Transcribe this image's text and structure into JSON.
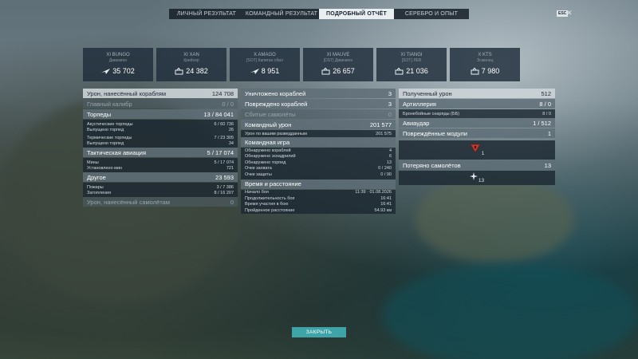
{
  "tabs": [
    "ЛИЧНЫЙ РЕЗУЛЬТАТ",
    "КОМАНДНЫЙ РЕЗУЛЬТАТ",
    "ПОДРОБНЫЙ ОТЧЁТ",
    "СЕРЕБРО И ОПЫТ"
  ],
  "active_tab": "ПОДРОБНЫЙ ОТЧЁТ",
  "esc_label": "ESC",
  "close_glyph": "✕",
  "ships": [
    {
      "name": "XI BUNGO",
      "sub": "Дивизион",
      "value": "35 702"
    },
    {
      "name": "XI XAN",
      "sub": "Крейсер",
      "value": "24 382"
    },
    {
      "name": "X AMAGO",
      "sub": "[SOT] Капитан сбил",
      "value": "8 951"
    },
    {
      "name": "XI MAUVE",
      "sub": "[DST] Дивизион",
      "value": "26 657"
    },
    {
      "name": "XI TIANGI",
      "sub": "[SOT] ЛЕВ",
      "value": "21 036"
    },
    {
      "name": "X KTS",
      "sub": "Эсминец",
      "value": "7 980"
    }
  ],
  "left": {
    "damage": {
      "label": "Урон, нанесённый кораблям",
      "value": "124 708"
    },
    "main_battery": {
      "label": "Главный калибр",
      "value": "0 / 0"
    },
    "torpedoes": {
      "label": "Торпеды",
      "value": "13 / 84 041"
    },
    "acoustic": {
      "label": "Акустические торпеды",
      "value": "6 / 60 736"
    },
    "acoustic_fired": {
      "label": "Выпущено торпед",
      "value": "26"
    },
    "thermal": {
      "label": "Термические торпеды",
      "value": "7 / 23 305"
    },
    "thermal_fired": {
      "label": "Выпущено торпед",
      "value": "34"
    },
    "aviation": {
      "label": "Тактическая авиация",
      "value": "5 / 17 074"
    },
    "mines": {
      "label": "Мины",
      "value": "5 / 17 074"
    },
    "mines_placed": {
      "label": "Установлено мин",
      "value": "721"
    },
    "other": {
      "label": "Другое",
      "value": "23 593"
    },
    "fires": {
      "label": "Пожары",
      "value": "3 / 7 386"
    },
    "floods": {
      "label": "Затопления",
      "value": "8 / 16 207"
    },
    "plane_damage": {
      "label": "Урон, нанесённый самолётам",
      "value": "0"
    }
  },
  "middle": {
    "destroyed": {
      "label": "Уничтожено кораблей",
      "value": "3"
    },
    "damaged": {
      "label": "Повреждено кораблей",
      "value": "3"
    },
    "planes_shot": {
      "label": "Сбитые самолёты",
      "value": "0"
    },
    "team_damage": {
      "label": "Командный урон",
      "value": "201 577"
    },
    "spotting_damage": {
      "label": "Урон по вашим разведданным",
      "value": "201 575"
    },
    "team_game": {
      "label": "Командная игра"
    },
    "detected_ships": {
      "label": "Обнаружено кораблей",
      "value": "4"
    },
    "detected_squadrons": {
      "label": "Обнаружено эскадрилий",
      "value": "6"
    },
    "detected_torpedoes": {
      "label": "Обнаружено торпед",
      "value": "13"
    },
    "capture_points": {
      "label": "Очки захвата",
      "value": "0 / 240"
    },
    "defense_points": {
      "label": "Очки защиты",
      "value": "0 / 90"
    },
    "time_distance": {
      "label": "Время и расстояние"
    },
    "battle_start": {
      "label": "Начало боя",
      "value": "11:39 · 01.08.2026"
    },
    "battle_duration": {
      "label": "Продолжительность боя",
      "value": "16:41"
    },
    "time_in_battle": {
      "label": "Время участия в бою",
      "value": "16:41"
    },
    "distance": {
      "label": "Пройденное расстояние",
      "value": "54.93 км"
    }
  },
  "right": {
    "received": {
      "label": "Полученный урон",
      "value": "512"
    },
    "artillery": {
      "label": "Артиллерия",
      "value": "8 / 0"
    },
    "ap_shells": {
      "label": "Бронебойные снаряды (ББ)",
      "value": "8 / 0"
    },
    "airstrike": {
      "label": "Авиаудар",
      "value": "1 / 512"
    },
    "modules": {
      "label": "Повреждённые модули",
      "value": "1"
    },
    "module_icon_count": "1",
    "planes_lost": {
      "label": "Потеряно самолётов",
      "value": "13"
    },
    "planes_icon_count": "13"
  },
  "close_button": "ЗАКРЫТЬ",
  "colors": {
    "accent": "#3fa4a8",
    "module_icon": "#c0392b"
  },
  "icons": [
    "plane-icon",
    "damage-icon",
    "module-damage-icon",
    "plane-lost-icon"
  ]
}
